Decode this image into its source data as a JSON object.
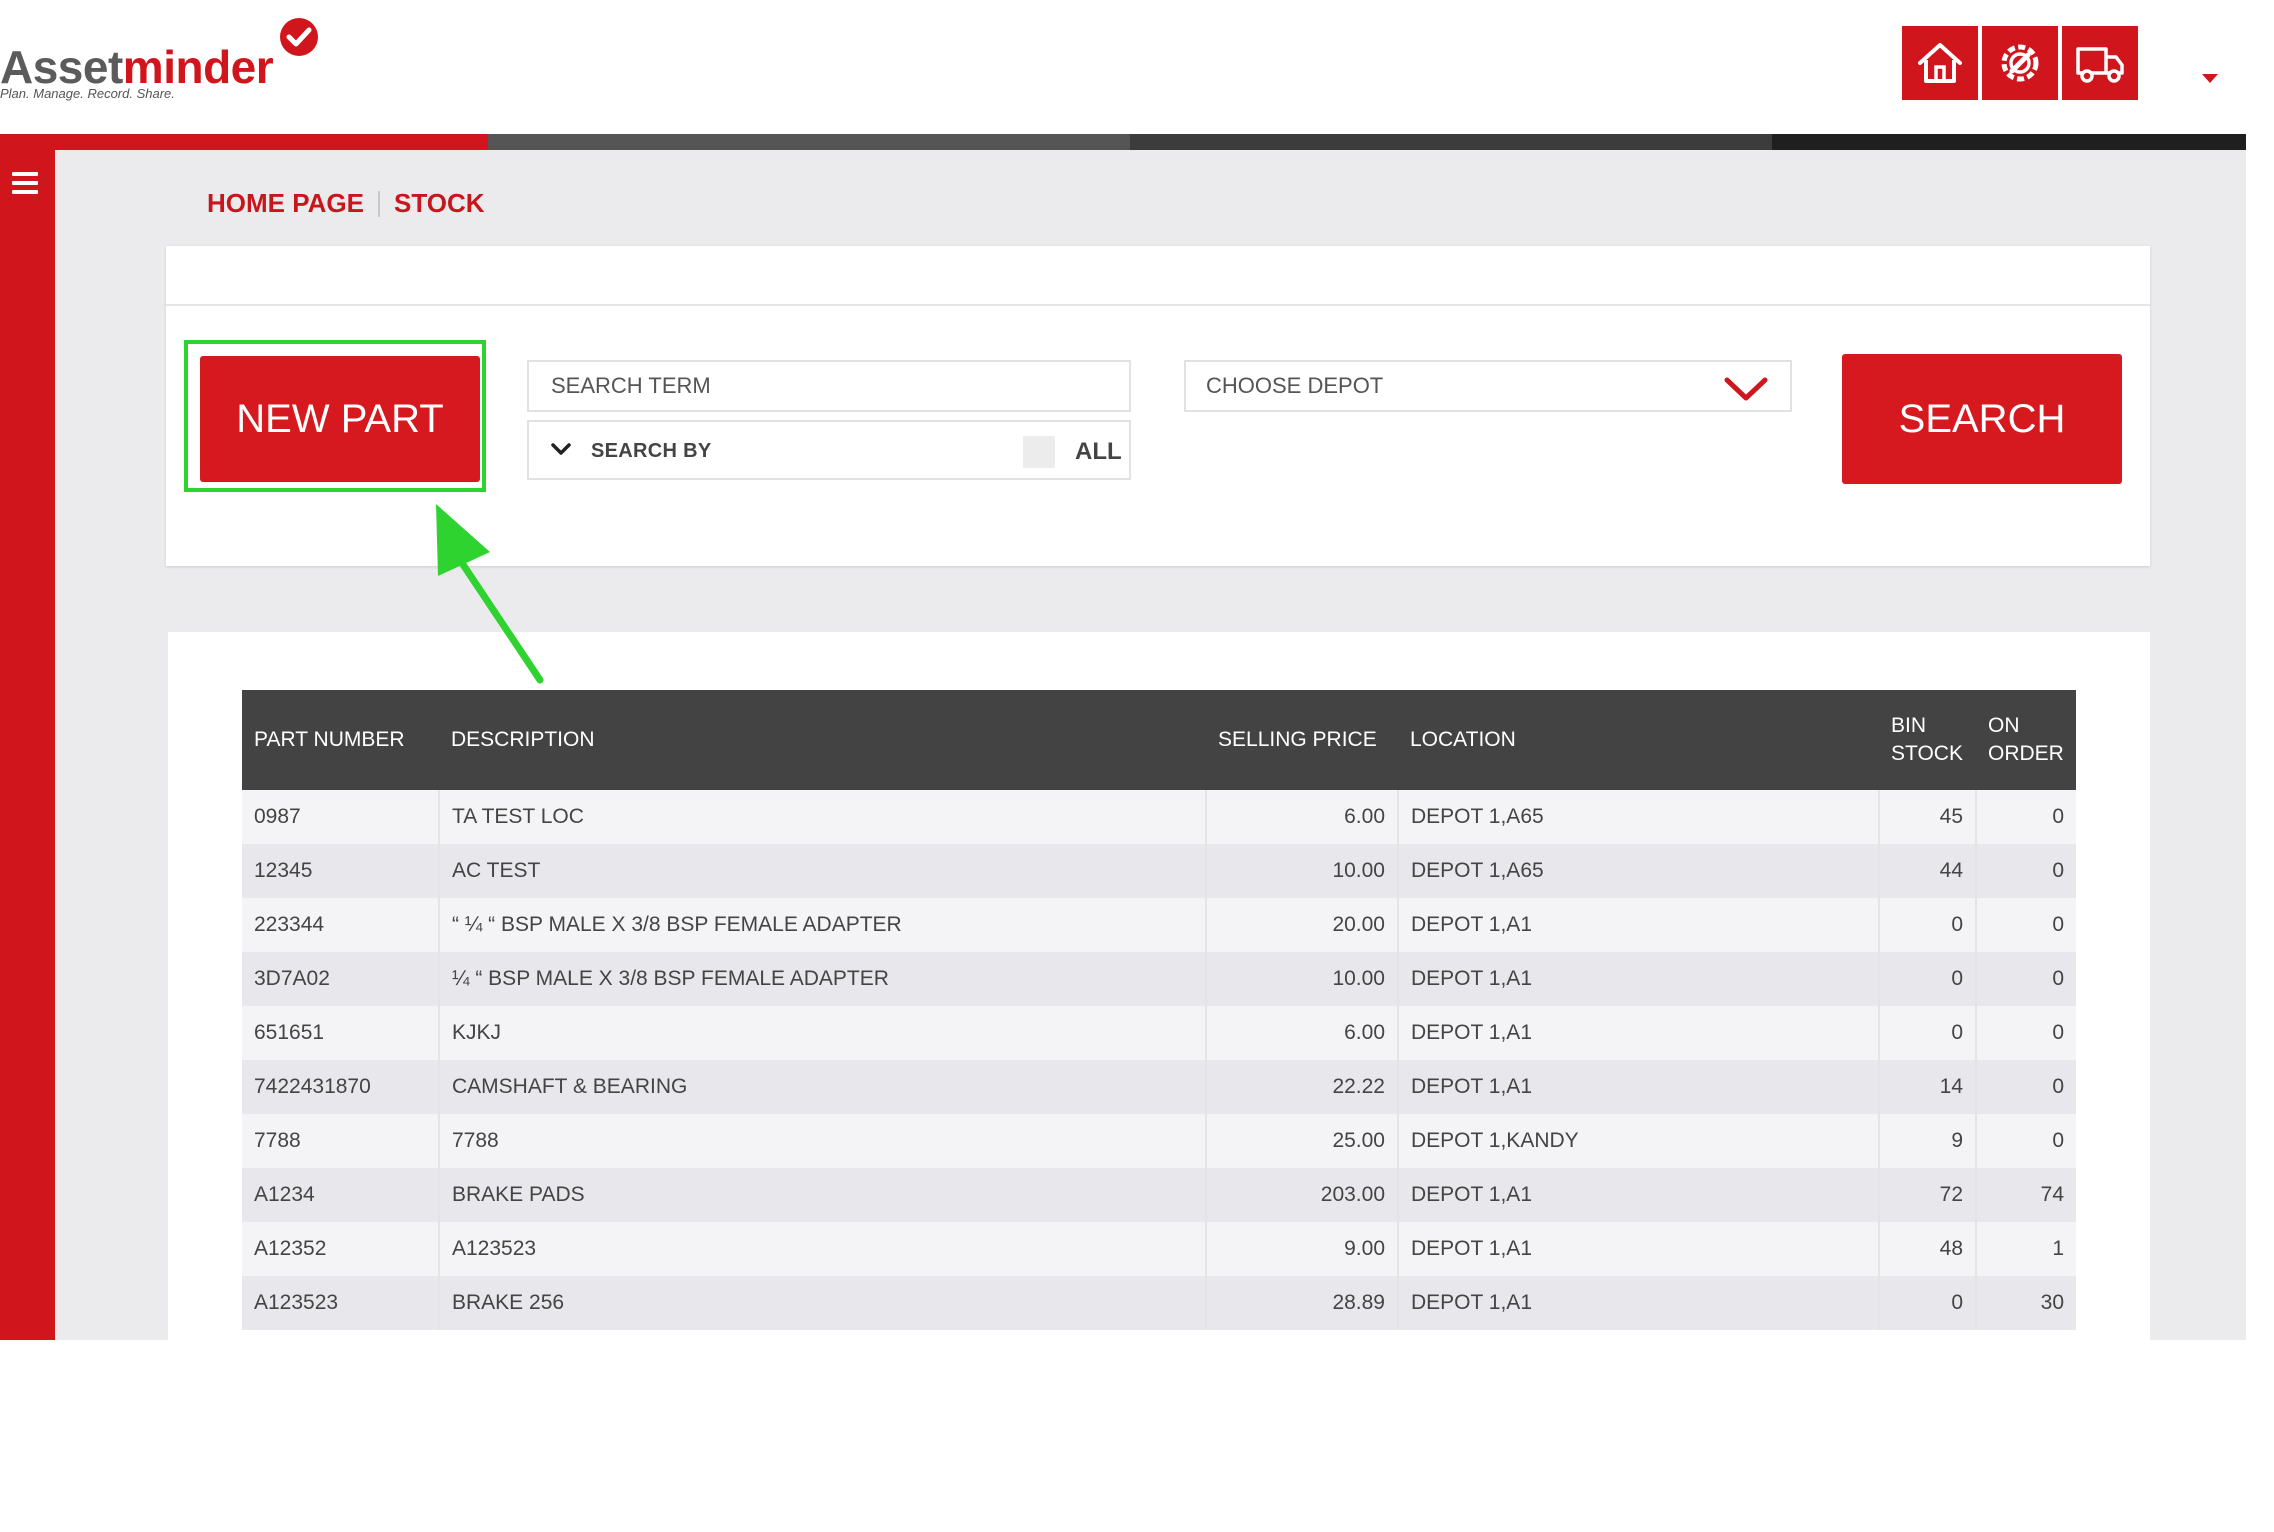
{
  "app": {
    "logo_asset": "Asset",
    "logo_minder": "minder",
    "tagline": "Plan. Manage. Record. Share.",
    "accent": "#d0161c",
    "header_icons": [
      "home-icon",
      "gear-wrench-icon",
      "truck-icon"
    ]
  },
  "breadcrumb": {
    "home": "HOME PAGE",
    "current": "STOCK"
  },
  "search": {
    "new_part_label": "NEW PART",
    "term_placeholder": "SEARCH TERM",
    "search_by_label": "SEARCH BY",
    "all_label": "ALL",
    "depot_placeholder": "CHOOSE DEPOT",
    "search_button": "SEARCH"
  },
  "table": {
    "headers": {
      "part_number": "PART NUMBER",
      "description": "DESCRIPTION",
      "selling_price": "SELLING PRICE",
      "location": "LOCATION",
      "bin_stock_1": "BIN",
      "bin_stock_2": "STOCK",
      "on_order_1": "ON",
      "on_order_2": "ORDER"
    },
    "rows": [
      {
        "part": "0987",
        "desc": "TA TEST LOC",
        "price": "6.00",
        "loc": "DEPOT 1,A65",
        "bin": "45",
        "order": "0"
      },
      {
        "part": "12345",
        "desc": "AC TEST",
        "price": "10.00",
        "loc": "DEPOT 1,A65",
        "bin": "44",
        "order": "0"
      },
      {
        "part": "223344",
        "desc": "“ ¼ “ BSP MALE X 3/8 BSP FEMALE ADAPTER",
        "price": "20.00",
        "loc": "DEPOT 1,A1",
        "bin": "0",
        "order": "0"
      },
      {
        "part": "3D7A02",
        "desc": "¼ “ BSP MALE X 3/8 BSP FEMALE ADAPTER",
        "price": "10.00",
        "loc": "DEPOT 1,A1",
        "bin": "0",
        "order": "0"
      },
      {
        "part": "651651",
        "desc": "KJKJ",
        "price": "6.00",
        "loc": "DEPOT 1,A1",
        "bin": "0",
        "order": "0"
      },
      {
        "part": "7422431870",
        "desc": "CAMSHAFT & BEARING",
        "price": "22.22",
        "loc": "DEPOT 1,A1",
        "bin": "14",
        "order": "0"
      },
      {
        "part": "7788",
        "desc": "7788",
        "price": "25.00",
        "loc": "DEPOT 1,KANDY",
        "bin": "9",
        "order": "0"
      },
      {
        "part": "A1234",
        "desc": "BRAKE PADS",
        "price": "203.00",
        "loc": "DEPOT 1,A1",
        "bin": "72",
        "order": "74"
      },
      {
        "part": "A12352",
        "desc": "A123523",
        "price": "9.00",
        "loc": "DEPOT 1,A1",
        "bin": "48",
        "order": "1"
      },
      {
        "part": "A123523",
        "desc": "BRAKE 256",
        "price": "28.89",
        "loc": "DEPOT 1,A1",
        "bin": "0",
        "order": "30"
      }
    ]
  }
}
